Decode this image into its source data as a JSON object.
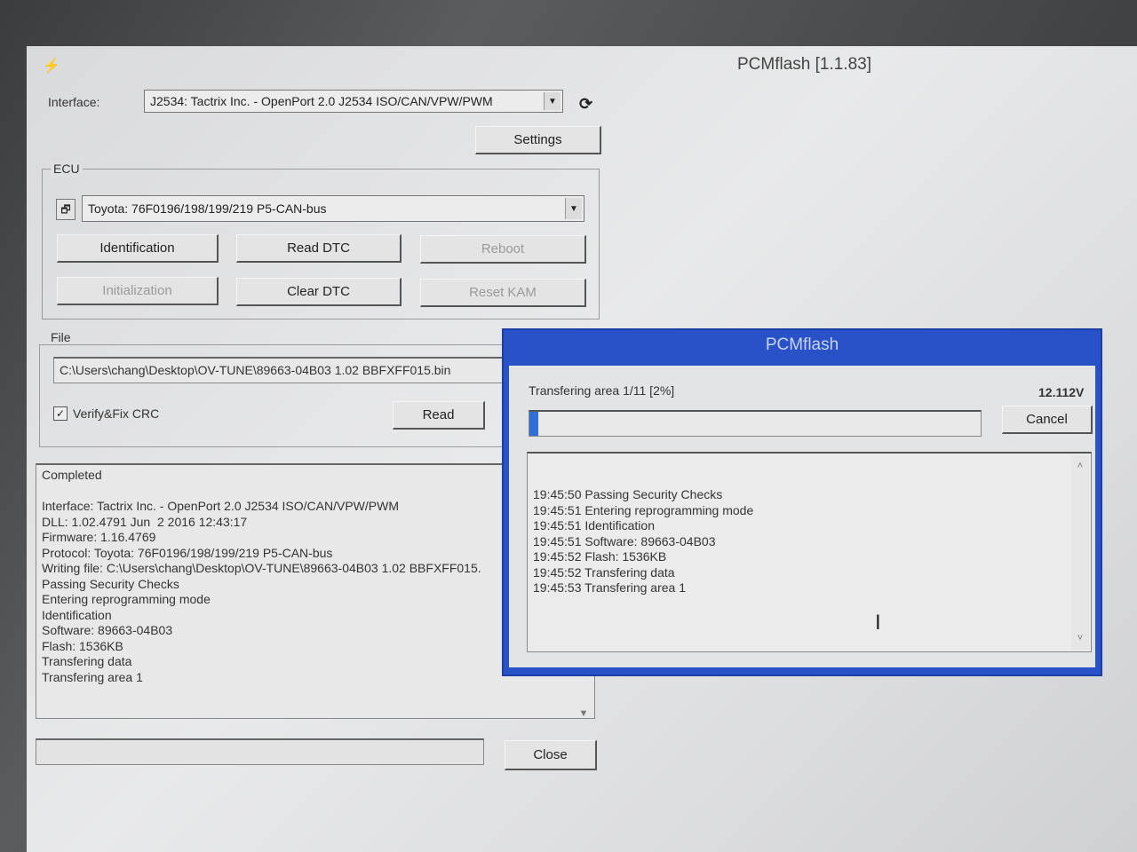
{
  "window": {
    "title": "PCMflash [1.1.83]"
  },
  "interface": {
    "label": "Interface:",
    "value": "J2534: Tactrix Inc. - OpenPort 2.0 J2534 ISO/CAN/VPW/PWM",
    "settings_label": "Settings"
  },
  "ecu": {
    "group_label": "ECU",
    "value": "Toyota: 76F0196/198/199/219 P5-CAN-bus",
    "buttons": {
      "identification": "Identification",
      "read_dtc": "Read DTC",
      "reboot": "Reboot",
      "initialization": "Initialization",
      "clear_dtc": "Clear DTC",
      "reset_kam": "Reset KAM"
    }
  },
  "file": {
    "group_label": "File",
    "path": "C:\\Users\\chang\\Desktop\\OV-TUNE\\89663-04B03 1.02 BBFXFF015.bin",
    "verify_label": "Verify&Fix CRC",
    "verify_checked": true,
    "read_label": "Read"
  },
  "main_log": {
    "status": "Completed",
    "lines": [
      "",
      "Interface: Tactrix Inc. - OpenPort 2.0 J2534 ISO/CAN/VPW/PWM",
      "DLL: 1.02.4791 Jun  2 2016 12:43:17",
      "Firmware: 1.16.4769",
      "Protocol: Toyota: 76F0196/198/199/219 P5-CAN-bus",
      "Writing file: C:\\Users\\chang\\Desktop\\OV-TUNE\\89663-04B03 1.02 BBFXFF015.",
      "Passing Security Checks",
      "Entering reprogramming mode",
      "Identification",
      "Software: 89663-04B03",
      "Flash: 1536KB",
      "Transfering data",
      "Transfering area 1"
    ]
  },
  "close_label": "Close",
  "dialog": {
    "title": "PCMflash",
    "status": "Transfering area 1/11 [2%]",
    "voltage": "12.112V",
    "progress_percent": 2,
    "cancel_label": "Cancel",
    "log_lines": [
      "19:45:50 Passing Security Checks",
      "19:45:51 Entering reprogramming mode",
      "19:45:51 Identification",
      "19:45:51 Software: 89663-04B03",
      "19:45:52 Flash: 1536KB",
      "19:45:52 Transfering data",
      "19:45:53 Transfering area 1"
    ]
  },
  "colors": {
    "dialog_frame": "#2a52c8",
    "progress_fill": "#2f6fd6"
  }
}
